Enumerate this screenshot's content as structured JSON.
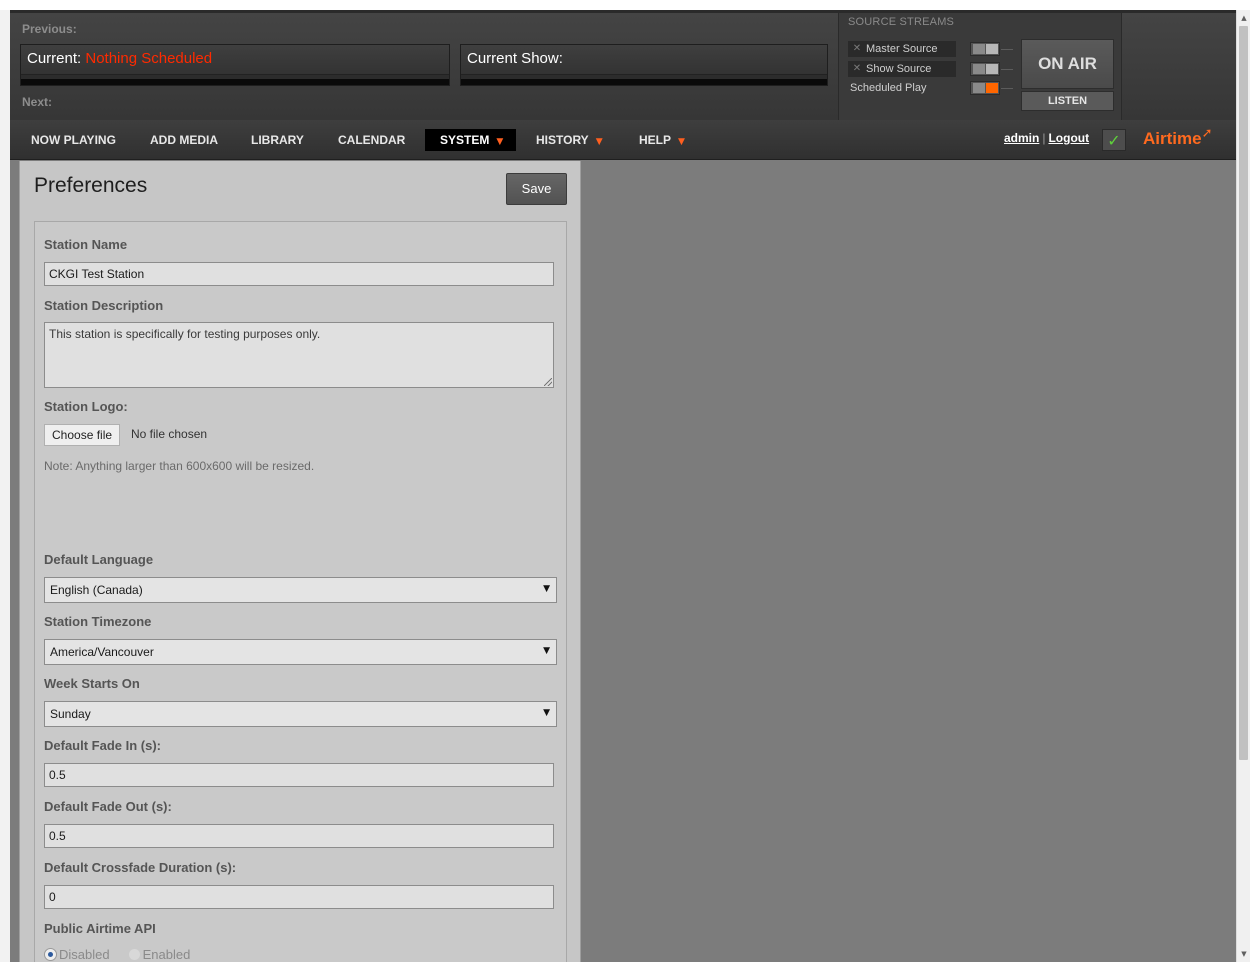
{
  "header": {
    "previous_label": "Previous:",
    "current_label": "Current:",
    "current_value": "Nothing Scheduled",
    "current_show_label": "Current Show:",
    "next_label": "Next:"
  },
  "source_streams": {
    "title": "SOURCE STREAMS",
    "master_label": "Master Source",
    "show_label": "Show Source",
    "scheduled_label": "Scheduled Play",
    "on_air_label": "ON AIR",
    "listen_label": "LISTEN"
  },
  "nav": {
    "items": [
      {
        "label": "NOW PLAYING"
      },
      {
        "label": "ADD MEDIA"
      },
      {
        "label": "LIBRARY"
      },
      {
        "label": "CALENDAR"
      },
      {
        "label": "SYSTEM"
      },
      {
        "label": "HISTORY"
      },
      {
        "label": "HELP"
      }
    ],
    "user_label": "admin",
    "separator": "|",
    "logout_label": "Logout",
    "brand": "Airtime"
  },
  "preferences": {
    "title": "Preferences",
    "save_label": "Save",
    "station_name_label": "Station Name",
    "station_name_value": "CKGI Test Station",
    "station_description_label": "Station Description",
    "station_description_value": "This station is specifically for testing purposes only.",
    "station_logo_label": "Station Logo:",
    "choose_file_label": "Choose file",
    "file_status": "No file chosen",
    "logo_note": "Note: Anything larger than 600x600 will be resized.",
    "default_language_label": "Default Language",
    "default_language_value": "English (Canada)",
    "timezone_label": "Station Timezone",
    "timezone_value": "America/Vancouver",
    "week_start_label": "Week Starts On",
    "week_start_value": "Sunday",
    "fade_in_label": "Default Fade In (s):",
    "fade_in_value": "0.5",
    "fade_out_label": "Default Fade Out (s):",
    "fade_out_value": "0.5",
    "crossfade_label": "Default Crossfade Duration (s):",
    "crossfade_value": "0",
    "public_api_label": "Public Airtime API",
    "api_disabled_label": "Disabled",
    "api_enabled_label": "Enabled",
    "api_selected": "Disabled"
  },
  "colors": {
    "accent": "#ff6a1f",
    "alert": "#ff2a00",
    "status_ok": "#5fd13b"
  },
  "icons": {
    "status": "checkmark-icon",
    "close": "close-icon",
    "caret": "caret-down-icon"
  }
}
